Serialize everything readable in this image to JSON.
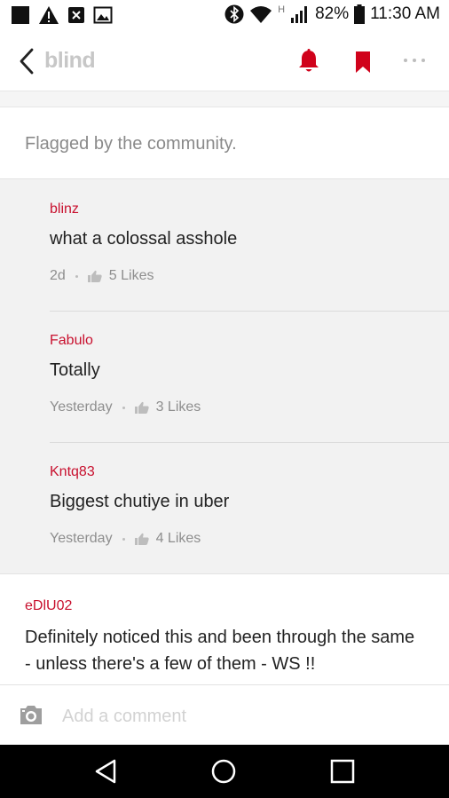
{
  "status_bar": {
    "battery": "82%",
    "time": "11:30 AM",
    "network_label": "H",
    "icons": [
      "square-icon",
      "warning-icon",
      "close-box-icon",
      "image-icon",
      "bluetooth-icon",
      "wifi-icon",
      "signal-icon",
      "battery-icon"
    ]
  },
  "header": {
    "brand": "blind",
    "icons": [
      "back-chevron-icon",
      "bell-icon",
      "bookmark-icon",
      "more-dots-icon"
    ],
    "accent_color": "#d0021b"
  },
  "flag_banner": {
    "text": "Flagged by the community."
  },
  "replies": [
    {
      "author": "blinz",
      "text": "what a colossal asshole",
      "time": "2d",
      "likes": "5 Likes"
    },
    {
      "author": "Fabulo",
      "text": "Totally",
      "time": "Yesterday",
      "likes": "3 Likes"
    },
    {
      "author": "Kntq83",
      "text": "Biggest chutiye in uber",
      "time": "Yesterday",
      "likes": "4 Likes"
    }
  ],
  "comment": {
    "author": "eDlU02",
    "text": "Definitely noticed this and been through the same - unless there's a few of them - WS !!"
  },
  "composer": {
    "placeholder": "Add a comment",
    "value": ""
  },
  "nav_bar": {
    "icons": [
      "nav-back-icon",
      "nav-home-icon",
      "nav-recent-icon"
    ]
  }
}
